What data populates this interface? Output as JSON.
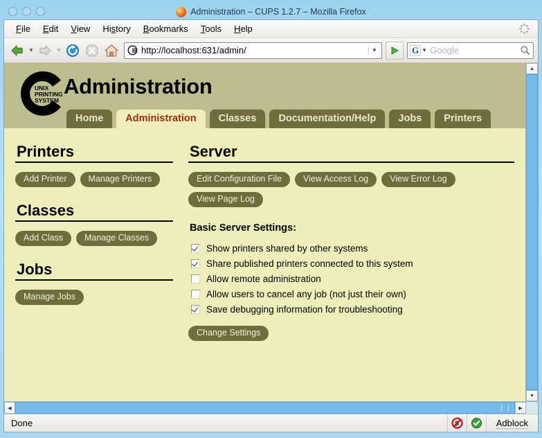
{
  "window": {
    "title": "Administration – CUPS 1.2.7 – Mozilla Firefox",
    "buttons": [
      "close",
      "minimize",
      "maximize"
    ]
  },
  "menubar": {
    "items": [
      {
        "label": "File",
        "mnemonic": "F"
      },
      {
        "label": "Edit",
        "mnemonic": "E"
      },
      {
        "label": "View",
        "mnemonic": "V"
      },
      {
        "label": "History",
        "mnemonic": "s"
      },
      {
        "label": "Bookmarks",
        "mnemonic": "B"
      },
      {
        "label": "Tools",
        "mnemonic": "T"
      },
      {
        "label": "Help",
        "mnemonic": "H"
      }
    ]
  },
  "navbar": {
    "back": "Back",
    "forward": "Forward",
    "reload": "Reload",
    "stop": "Stop",
    "home": "Home",
    "url": "http://localhost:631/admin/",
    "go": "Go",
    "search_engine": "G",
    "search_placeholder": "Google"
  },
  "page": {
    "title": "Administration",
    "logo_text": [
      "UNIX",
      "PRINTING",
      "SYSTEM"
    ],
    "tabs": [
      {
        "label": "Home",
        "active": false
      },
      {
        "label": "Administration",
        "active": true
      },
      {
        "label": "Classes",
        "active": false
      },
      {
        "label": "Documentation/Help",
        "active": false
      },
      {
        "label": "Jobs",
        "active": false
      },
      {
        "label": "Printers",
        "active": false
      }
    ],
    "left_sections": [
      {
        "heading": "Printers",
        "buttons": [
          "Add Printer",
          "Manage Printers"
        ]
      },
      {
        "heading": "Classes",
        "buttons": [
          "Add Class",
          "Manage Classes"
        ]
      },
      {
        "heading": "Jobs",
        "buttons": [
          "Manage Jobs"
        ]
      }
    ],
    "server": {
      "heading": "Server",
      "buttons": [
        "Edit Configuration File",
        "View Access Log",
        "View Error Log",
        "View Page Log"
      ],
      "settings_heading": "Basic Server Settings:",
      "settings": [
        {
          "label": "Show printers shared by other systems",
          "checked": true
        },
        {
          "label": "Share published printers connected to this system",
          "checked": true
        },
        {
          "label": "Allow remote administration",
          "checked": false
        },
        {
          "label": "Allow users to cancel any job (not just their own)",
          "checked": false
        },
        {
          "label": "Save debugging information for troubleshooting",
          "checked": true
        }
      ],
      "submit_label": "Change Settings"
    }
  },
  "statusbar": {
    "status": "Done",
    "adblock": "Adblock"
  },
  "colors": {
    "page_bg": "#eeeebb",
    "header_bg": "#bdbd8e",
    "tab_bg": "#6e6e3c",
    "tab_active_text": "#a02b10",
    "button_bg": "#6e6e3c",
    "titlebar_bg": "#a7d6f0"
  }
}
